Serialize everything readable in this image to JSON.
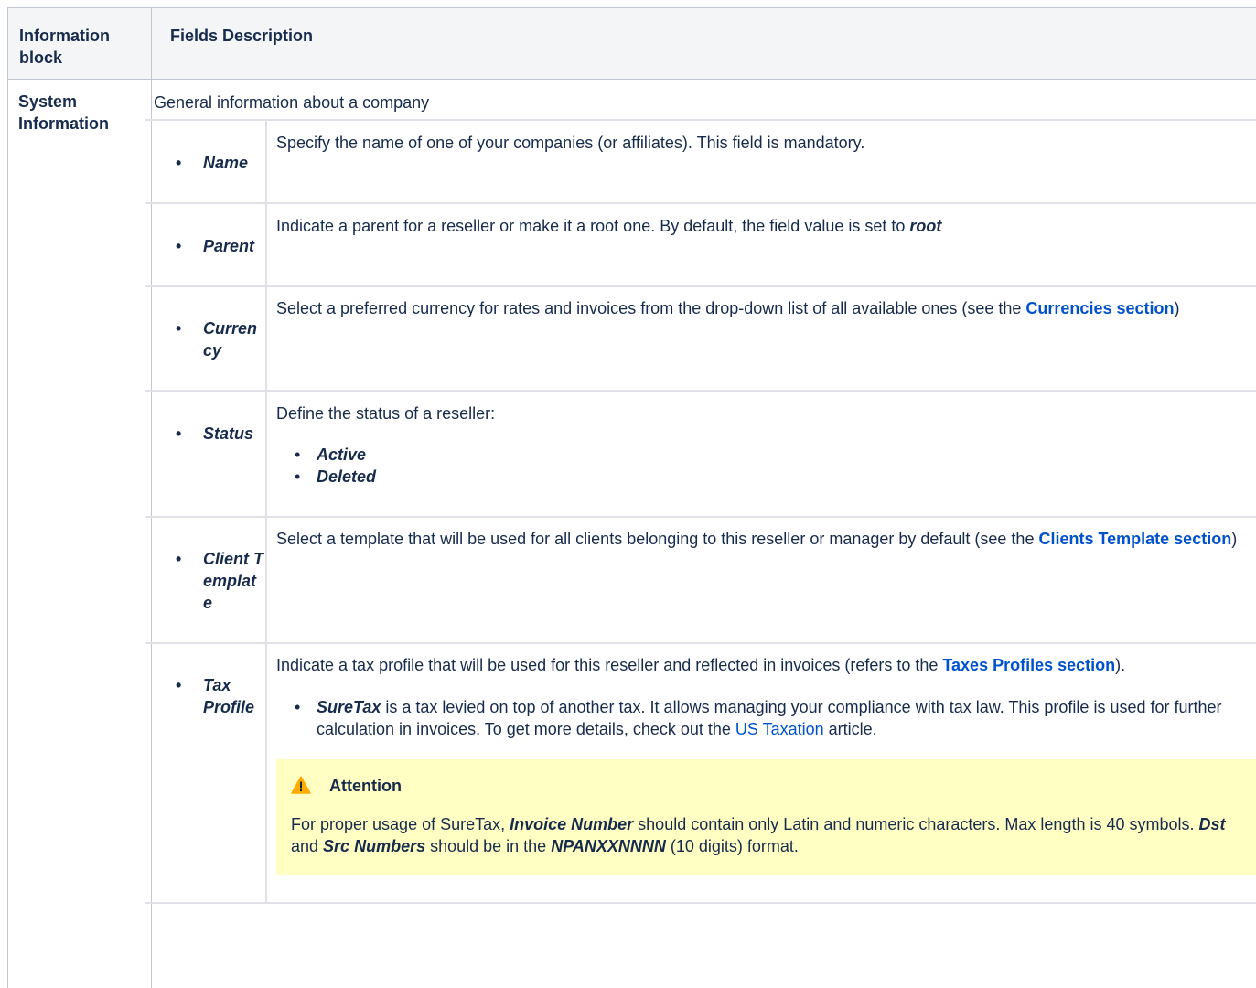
{
  "table": {
    "headers": [
      "Information block",
      "Fields Description"
    ],
    "block_name": "System Information",
    "block_description": "General information about a company",
    "rows": [
      {
        "label": "Name",
        "description": "Specify the name of one of your companies (or affiliates). This field is mandatory."
      },
      {
        "label": "Parent",
        "description_pre": "Indicate a parent for a reseller or make it a root one. By default, the field value is set to ",
        "description_bold": "root"
      },
      {
        "label": "Currency",
        "description_pre": "Select a preferred currency for rates and invoices from the drop-down list of all available ones (see the ",
        "link": "Currencies section",
        "description_post": ")"
      },
      {
        "label": "Status",
        "description": "Define the status of a reseller:",
        "options": [
          "Active",
          "Deleted"
        ]
      },
      {
        "label": "Client Template",
        "description_pre": "Select a template that will be used for all clients belonging to this reseller or manager by default (see the ",
        "link": "Clients Template section",
        "description_post": ")"
      },
      {
        "label": "Tax Profile",
        "description_pre": "Indicate a tax profile that will be used for this reseller and reflected in invoices (refers to the ",
        "link": "Taxes Profiles section",
        "description_post": ").",
        "subitem_bold": "SureTax",
        "subitem_text": " is a tax levied on top of another tax. It allows managing your compliance with tax law. This profile is used for further calculation in invoices. To get more details, check out the ",
        "subitem_link": "US Taxation",
        "subitem_post": " article."
      }
    ]
  },
  "note": {
    "icon": "warning-icon",
    "title": "Attention",
    "text_1": "For proper usage of SureTax, ",
    "bold_1": "Invoice Number",
    "text_2": " should contain only Latin and numeric characters. Max length is 40 symbols. ",
    "bold_2": "Dst",
    "text_3": " and ",
    "bold_3": "Src Numbers",
    "text_4": " should be in the ",
    "bold_4": "NPANXXNNNN",
    "text_5": " (10 digits) format."
  },
  "colors": {
    "link": "#0052cc",
    "note_background": "#ffffc4",
    "header_background": "#f4f5f7",
    "warning": "#ffab00"
  }
}
